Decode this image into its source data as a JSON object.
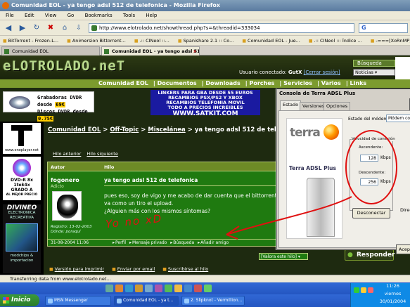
{
  "window": {
    "title": "Comunidad EOL - ya tengo adsl 512 de telefonica - Mozilla Firefox"
  },
  "menu": [
    "File",
    "Edit",
    "View",
    "Go",
    "Bookmarks",
    "Tools",
    "Help"
  ],
  "url": "http://www.elotrolado.net/showthread.php?s=&threadid=333034",
  "search_logo": "G",
  "bookmarks": [
    "BitTorrent - Frozen-L...",
    "Animersion Bittorrent...",
    ".:: CINeol ::...",
    "Spanishare 2.1 :: Co...",
    "Comunidad EOL - Jue...",
    ".:: CINeol ::: Índice ...",
    "-===[XoRnMP]===- es..."
  ],
  "tabs": [
    {
      "label": "Comunidad EOL",
      "active": false
    },
    {
      "label": "Comunidad EOL - ya tengo adsl 512 d...",
      "active": true
    }
  ],
  "site": {
    "logo": "eLOTROLADO.neT",
    "user_prefix": "Usuario conectado:",
    "user": "GutX",
    "logout": "[Cerrar sesión]",
    "search_btn": "Búsqueda",
    "news_select": "Noticias",
    "nav": [
      "Comunidad EOL",
      "Documentos",
      "Downloads",
      "Porches",
      "Servicios",
      "Varios",
      "Links"
    ]
  },
  "ads": {
    "promo1_line1": "Grabadoras DVDR desde",
    "promo1_price1": "69€",
    "promo1_line2": "Discos DVDR desde",
    "promo1_price2": "0.75€",
    "promo2_lines": [
      "LINKERS PARA GBA DESDE 55 EUROS",
      "RECAMBIOS PSX/PS2 Y XBOX",
      "RECAMBIOS TELEFONIA MOVIL",
      "TODO A PRECIOS INCREIBLES"
    ],
    "promo2_site": "WWW.SATKIT.COM",
    "left_ad1": "www.oneplayer.net",
    "left_ad2_title": "DVD-R 8x 1tek4x",
    "left_ad2_sub": "GRADO A",
    "left_ad2_small": "AL MEJOR PRECIO",
    "left_ad3_name": "DIVINEO",
    "left_ad3_sub": "ELECTRONICA RECREATIVA",
    "left_ad3_small": "modchips & importacion"
  },
  "thread": {
    "breadcrumb": [
      "Comunidad EOL",
      "Off-Topic",
      "Miscelánea"
    ],
    "title": "ya tengo adsl 512 de telefonica",
    "sep": ">",
    "prev": "Hilo anterior",
    "next": "Hilo siguiente",
    "col_author": "Autor",
    "col_thread": "Hilo",
    "author": "fogonero",
    "rank": "Adicto",
    "registered": "Registro: 13-02-2003",
    "location": "Dónde: poraquí",
    "post_title": "ya tengo adsl 512 de telefonica",
    "post_body_1": "pues eso, soy de vigo y me acabo de dar cuenta que el bittorrent va como un tiro el upload.",
    "post_body_2": "¿Alguien más con los mismos síntomas?",
    "date": "31-08-2004 11:06",
    "actions": [
      "Perfil",
      "Mensaje privado",
      "Búsqueda",
      "Añadir amigo"
    ],
    "rate_select": "[Valora este hilo]",
    "reply": "Responder",
    "bottom_links": [
      "Versión para imprimir",
      "Enviar por email",
      "Suscribirse al hilo"
    ]
  },
  "terra": {
    "title": "Consola de Terra ADSL Plus",
    "tabs": [
      "Estado",
      "Versiones",
      "Opciones"
    ],
    "brand": "terra",
    "model": "Terra ADSL Plus",
    "state_label": "Estado del módem:",
    "state_value": "Módem conectado",
    "speed_group": "Velocidad de conexión",
    "up_label": "Ascendente:",
    "up_value": "128",
    "down_label": "Descendente:",
    "down_value": "256",
    "unit": "Kbps",
    "disconnect": "Desconectar",
    "dir_label": "Direcc",
    "ok": "Acepta"
  },
  "annotation": {
    "text": "Yo no xD",
    "color": "#e01010"
  },
  "status": "Transferring data from www.elotrolado.net...",
  "taskbar": {
    "start": "Inicio",
    "tasks": [
      "MSN Messenger",
      "Comunidad EOL - ya t...",
      "2. Slipknot - Vermillion..."
    ],
    "time": "11:26",
    "day": "viernes",
    "date": "30/01/2004"
  }
}
